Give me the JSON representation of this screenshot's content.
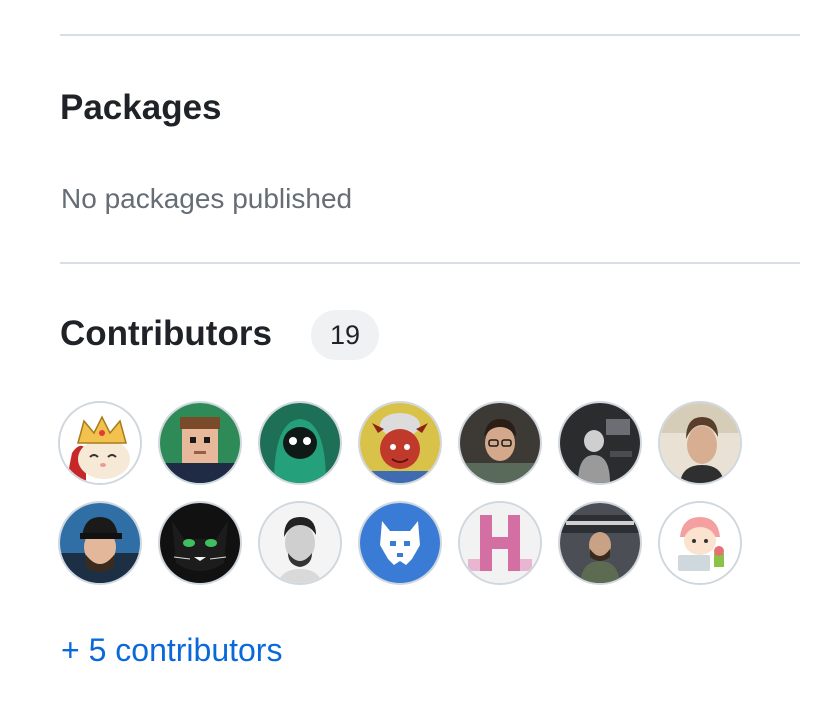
{
  "packages": {
    "title": "Packages",
    "empty_text": "No packages published"
  },
  "contributors": {
    "title": "Contributors",
    "count": "19",
    "more_link": "+ 5 contributors",
    "avatars": [
      {
        "icon": "crowned-cat-avatar-icon"
      },
      {
        "icon": "pixel-man-avatar-icon"
      },
      {
        "icon": "hooded-creature-avatar-icon"
      },
      {
        "icon": "red-devil-avatar-icon"
      },
      {
        "icon": "man-photo-avatar-icon"
      },
      {
        "icon": "desk-photo-avatar-icon"
      },
      {
        "icon": "man-portrait-avatar-icon"
      },
      {
        "icon": "man-cap-avatar-icon"
      },
      {
        "icon": "black-cat-avatar-icon"
      },
      {
        "icon": "bearded-man-avatar-icon"
      },
      {
        "icon": "white-wolf-avatar-icon"
      },
      {
        "icon": "pixel-h-avatar-icon"
      },
      {
        "icon": "game-jam-photo-avatar-icon"
      },
      {
        "icon": "cartoon-laptop-avatar-icon"
      }
    ]
  },
  "colors": {
    "link": "#0969da",
    "muted_text": "#656d76",
    "badge_bg": "#eff1f3",
    "divider": "#d8dee4"
  }
}
